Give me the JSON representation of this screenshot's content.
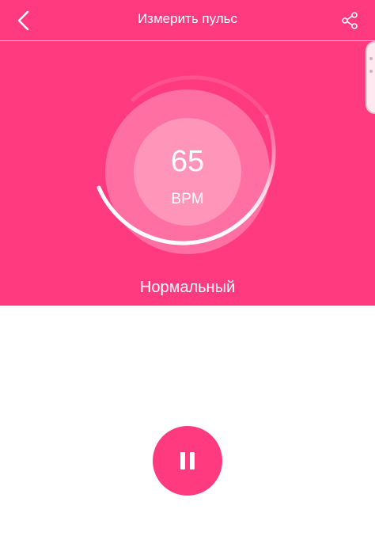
{
  "header": {
    "title": "Измерить пульс",
    "back_icon": "chevron-left-icon",
    "share_icon": "share-icon"
  },
  "measurement": {
    "value": "65",
    "unit": "BPM",
    "status": "Нормальный"
  },
  "controls": {
    "pause_icon": "pause-icon"
  },
  "colors": {
    "accent": "#ff3a7f",
    "background": "#ffffff",
    "text_on_accent": "#ffffff"
  }
}
